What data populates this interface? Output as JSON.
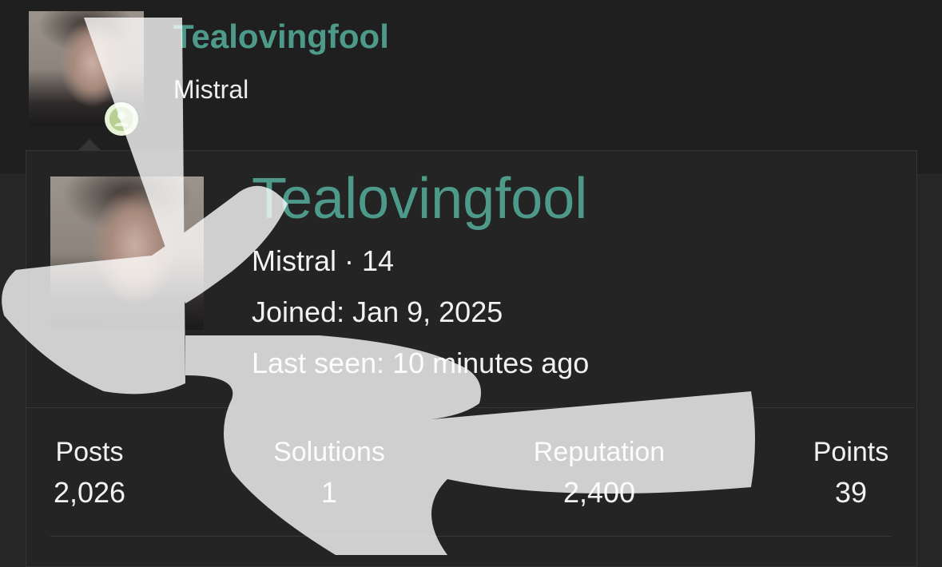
{
  "post_header": {
    "username": "Tealovingfool",
    "user_title": "Mistral"
  },
  "member_card": {
    "username": "Tealovingfool",
    "title_line": "Mistral · 14",
    "joined": "Joined: Jan 9, 2025",
    "last_seen": "Last seen: 10 minutes ago",
    "stats": [
      {
        "label": "Posts",
        "value": "2,026"
      },
      {
        "label": "Solutions",
        "value": "1"
      },
      {
        "label": "Reputation",
        "value": "2,400"
      },
      {
        "label": "Points",
        "value": "39"
      }
    ]
  },
  "icons": {
    "status_badge": "user-circle-icon"
  },
  "colors": {
    "username": "#4e9a8a",
    "background": "#262626",
    "header_bg": "#1f1f1f",
    "status_badge": "#e7f2d6",
    "status_icon": "#b7cf95"
  }
}
